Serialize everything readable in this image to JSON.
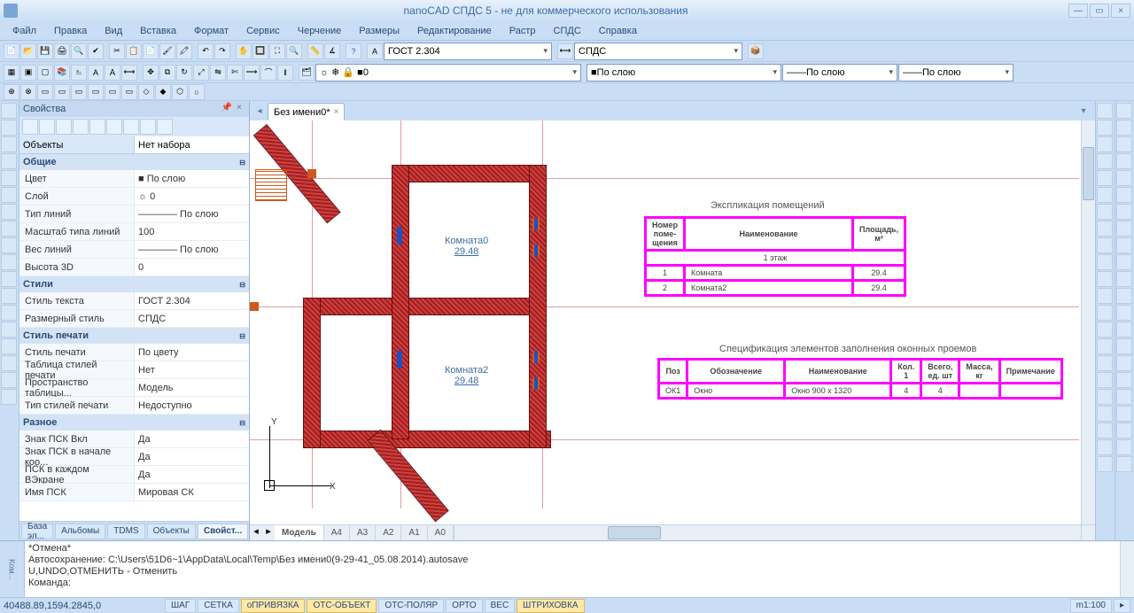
{
  "titlebar": {
    "title": "nanoCAD СПДС 5 - не для коммерческого использования"
  },
  "menu": [
    "Файл",
    "Правка",
    "Вид",
    "Вставка",
    "Формат",
    "Сервис",
    "Черчение",
    "Размеры",
    "Редактирование",
    "Растр",
    "СПДС",
    "Справка"
  ],
  "toolbar1": {
    "text_style": "ГОСТ 2.304",
    "dim_style": "СПДС"
  },
  "layer": "0",
  "bylayer": "По слою",
  "panel": {
    "title": "Свойства",
    "objects_label": "Объекты",
    "objects_value": "Нет набора",
    "groups": [
      {
        "name": "Общие",
        "rows": [
          {
            "k": "Цвет",
            "v": "■ По слою"
          },
          {
            "k": "Слой",
            "v": "☼ 0"
          },
          {
            "k": "Тип линий",
            "v": "———— По слою"
          },
          {
            "k": "Масштаб типа линий",
            "v": "100"
          },
          {
            "k": "Вес линий",
            "v": "———— По слою"
          },
          {
            "k": "Высота 3D",
            "v": "0"
          }
        ]
      },
      {
        "name": "Стили",
        "rows": [
          {
            "k": "Стиль текста",
            "v": "ГОСТ 2.304"
          },
          {
            "k": "Размерный стиль",
            "v": "СПДС"
          }
        ]
      },
      {
        "name": "Стиль печати",
        "rows": [
          {
            "k": "Стиль печати",
            "v": "По цвету"
          },
          {
            "k": "Таблица стилей печати",
            "v": "Нет"
          },
          {
            "k": "Пространство таблицы...",
            "v": "Модель"
          },
          {
            "k": "Тип стилей печати",
            "v": "Недоступно"
          }
        ]
      },
      {
        "name": "Разное",
        "rows": [
          {
            "k": "Знак ПСК Вкл",
            "v": "Да"
          },
          {
            "k": "Знак ПСК в начале коо...",
            "v": "Да"
          },
          {
            "k": "ПСК в каждом ВЭкране",
            "v": "Да"
          },
          {
            "k": "Имя ПСК",
            "v": "Мировая СК"
          }
        ]
      }
    ],
    "tabs": [
      "База эл...",
      "Альбомы",
      "TDMS",
      "Объекты",
      "Свойст..."
    ]
  },
  "doc": {
    "name": "Без имени0*"
  },
  "layouts": [
    "Модель",
    "A4",
    "A3",
    "A2",
    "A1",
    "A0"
  ],
  "drawing": {
    "axis_y": "Y",
    "axis_x": "X",
    "room1": {
      "name": "Комната0",
      "area": "29.48"
    },
    "room2": {
      "name": "Комната2",
      "area": "29.48"
    },
    "explication": {
      "title": "Экспликация помещений",
      "h": [
        "Номер поме- щения",
        "Наименование",
        "Площадь, м²"
      ],
      "floor": "1 этаж",
      "rows": [
        [
          "1",
          "Комната",
          "29.4"
        ],
        [
          "2",
          "Комната2",
          "29.4"
        ]
      ]
    },
    "spec": {
      "title": "Спецификация элементов заполнения оконных проемов",
      "h": [
        "Поз",
        "Обозначение",
        "Наименование",
        "Кол. 1",
        "Всего, ед. шт",
        "Масса, кг",
        "Примечание"
      ],
      "rows": [
        [
          "ОК1",
          "Окно",
          "Окно 900 x 1320",
          "4",
          "4",
          "",
          ""
        ]
      ]
    }
  },
  "cmd": {
    "l1": "*Отмена*",
    "l2": "Автосохранение: C:\\Users\\51D6~1\\AppData\\Local\\Temp\\Без имени0(9-29-41_05.08.2014).autosave",
    "l3": "U,UNDO,ОТМЕНИТЬ - Отменить",
    "l4": "Команда:"
  },
  "status": {
    "coords": "40488.89,1594.2845,0",
    "btns": [
      {
        "t": "ШАГ",
        "on": false
      },
      {
        "t": "СЕТКА",
        "on": false
      },
      {
        "t": "оПРИВЯЗКА",
        "on": true
      },
      {
        "t": "ОТС-ОБЪЕКТ",
        "on": true
      },
      {
        "t": "ОТС-ПОЛЯР",
        "on": false
      },
      {
        "t": "ОРТО",
        "on": false
      },
      {
        "t": "ВЕС",
        "on": false
      },
      {
        "t": "ШТРИХОВКА",
        "on": true
      }
    ],
    "scale": "m1:100"
  }
}
